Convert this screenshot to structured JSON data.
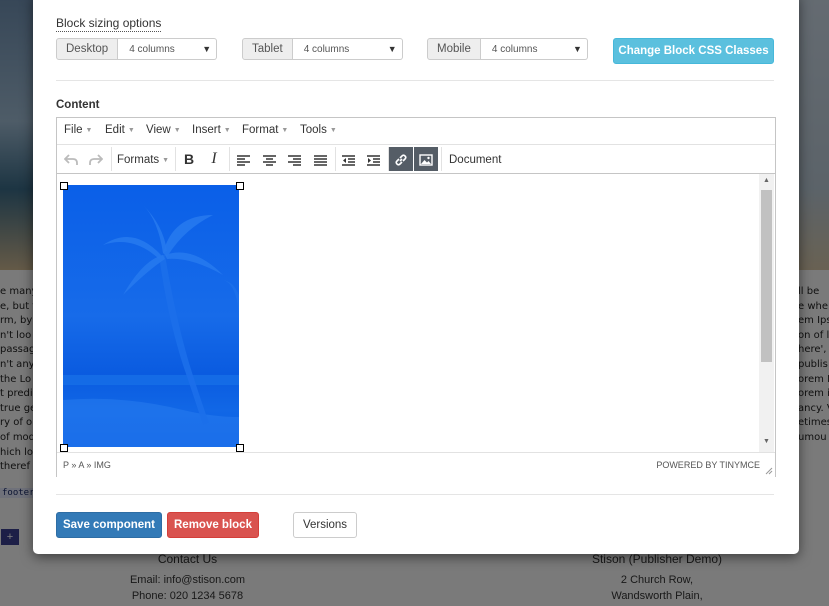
{
  "background": {
    "text_left": [
      "e many",
      "e, but t",
      "rm, by",
      "n't loo",
      "passag",
      "n't anyt",
      "the Lo",
      "t predi",
      "true ge",
      "ry of o",
      "of mod",
      "hich lo",
      "theref",
      ""
    ],
    "text_right": [
      "ll be",
      "e whe",
      "em Ips",
      "on of le",
      "here',",
      "publis",
      "orem I",
      "orem i",
      "ancy. V",
      "etimes",
      "umou",
      "",
      "",
      ""
    ],
    "footer_tag": "footer",
    "plus_label": "+",
    "contact": {
      "heading": "Contact Us",
      "email": "Email: info@stison.com",
      "phone": "Phone: 020 1234 5678"
    },
    "publisher": {
      "heading": "Stison (Publisher Demo)",
      "address1": "2 Church Row,",
      "address2": "Wandsworth Plain,"
    }
  },
  "modal": {
    "sizing_title": "Block sizing options",
    "sizes": [
      {
        "device": "Desktop",
        "value": "4 columns"
      },
      {
        "device": "Tablet",
        "value": "4 columns"
      },
      {
        "device": "Mobile",
        "value": "4 columns"
      }
    ],
    "css_button": "Change Block CSS Classes",
    "content_label": "Content",
    "editor": {
      "menu": [
        "File",
        "Edit",
        "View",
        "Insert",
        "Format",
        "Tools"
      ],
      "formats_label": "Formats",
      "bold_label": "B",
      "italic_label": "I",
      "document_label": "Document",
      "path": "P » A » IMG",
      "powered": "POWERED BY TINYMCE"
    },
    "buttons": {
      "save": "Save component",
      "remove": "Remove block",
      "versions": "Versions"
    }
  }
}
